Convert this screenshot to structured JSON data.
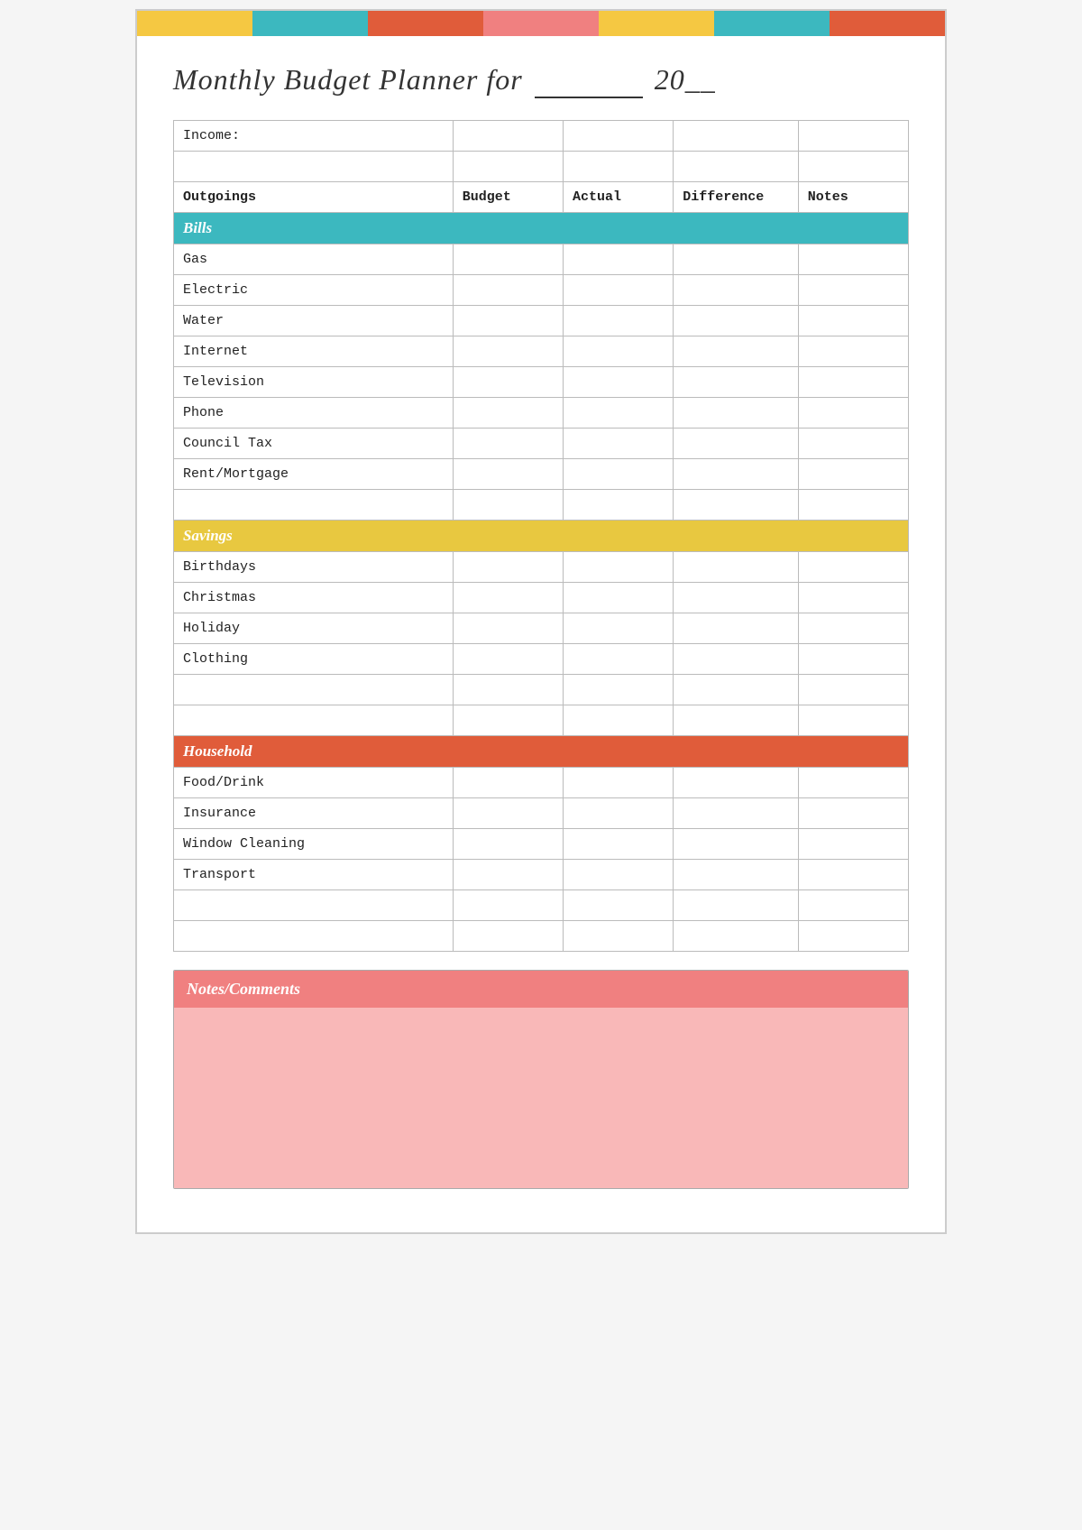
{
  "title": {
    "part1": "Monthly Budget Planner for",
    "underscore": "___________",
    "year": "20__"
  },
  "colorBars": {
    "top": [
      "#f5c842",
      "#3cb8bf",
      "#e05c3a",
      "#f08080",
      "#f5c842",
      "#3cb8bf",
      "#e05c3a"
    ],
    "bottom": [
      "#f5c842",
      "#3cb8bf",
      "#e05c3a",
      "#f08080",
      "#f5c842",
      "#3cb8bf",
      "#e05c3a"
    ]
  },
  "table": {
    "income_label": "Income:",
    "headers": {
      "outgoings": "Outgoings",
      "budget": "Budget",
      "actual": "Actual",
      "difference": "Difference",
      "notes": "Notes"
    },
    "sections": {
      "bills": {
        "label": "Bills",
        "items": [
          "Gas",
          "Electric",
          "Water",
          "Internet",
          "Television",
          "Phone",
          "Council Tax",
          "Rent/Mortgage"
        ]
      },
      "savings": {
        "label": "Savings",
        "items": [
          "Birthdays",
          "Christmas",
          "Holiday",
          "Clothing"
        ]
      },
      "household": {
        "label": "Household",
        "items": [
          "Food/Drink",
          "Insurance",
          "Window Cleaning",
          "Transport"
        ]
      }
    }
  },
  "notes": {
    "label": "Notes/Comments"
  }
}
